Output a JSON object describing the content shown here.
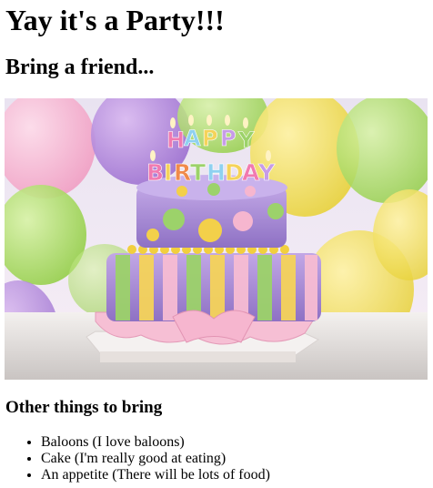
{
  "page": {
    "title": "Yay it's a Party!!!",
    "subtitle": "Bring a friend...",
    "photo": {
      "subject": "birthday-cake-with-balloons",
      "candle_letters": [
        "H",
        "A",
        "P",
        "P",
        "Y",
        "B",
        "I",
        "R",
        "T",
        "H",
        "D",
        "A",
        "Y"
      ]
    },
    "list_heading": "Other things to bring",
    "items": [
      "Baloons (I love baloons)",
      "Cake (I'm really good at eating)",
      "An appetite (There will be lots of food)"
    ]
  },
  "colors": {
    "text": "#000000",
    "background": "#ffffff",
    "cake_purple": "#a98fd6",
    "cake_pink": "#f4b6cf",
    "dots_green": "#8cc84b",
    "dots_yellow": "#f3d04a"
  }
}
